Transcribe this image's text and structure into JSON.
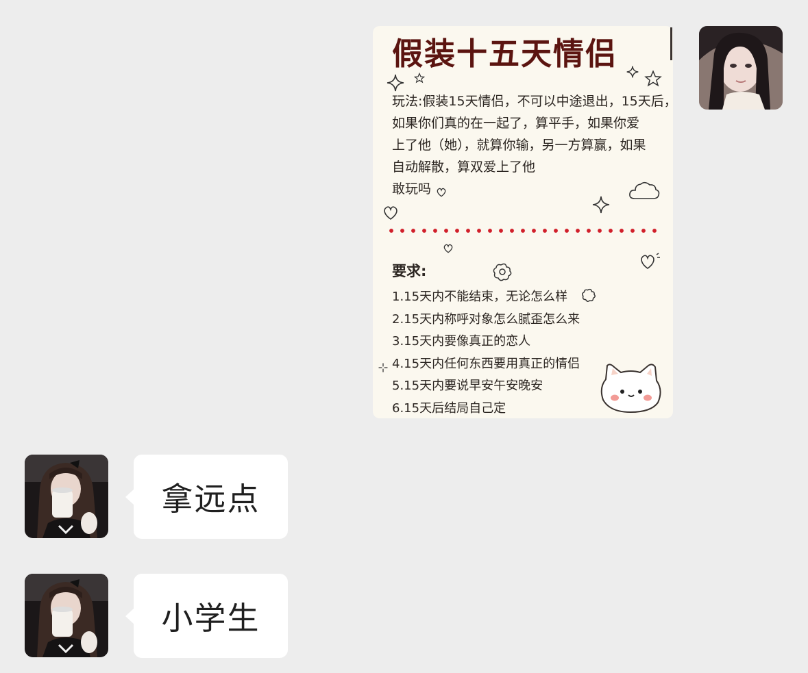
{
  "messages": {
    "image_post": {
      "sender": "me",
      "title": "假装十五天情侣",
      "rules_lines": [
        "玩法:假装15天情侣，不可以中途退出，15天后，",
        "如果你们真的在一起了，算平手，如果你爱",
        "上了他（她），就算你输，另一方算赢，如果",
        "自动解散，算双爱上了他",
        "敢玩吗"
      ],
      "requirements_title": "要求:",
      "requirements": [
        "1.15天内不能结束，无论怎么样",
        "2.15天内称呼对象怎么腻歪怎么来",
        "3.15天内要像真正的恋人",
        "4.15天内任何东西要用真正的情侣",
        "5.15天内要说早安午安晚安",
        "6.15天后结局自己定"
      ],
      "accent_colors": {
        "title": "#5b1410",
        "divider_dots": "#d11f2a",
        "card_background": "#fbf8ef"
      }
    },
    "reply_1": {
      "sender": "other",
      "text": "拿远点"
    },
    "reply_2": {
      "sender": "other",
      "text": "小学生"
    }
  },
  "colors": {
    "chat_background": "#ededed",
    "bubble_background": "#ffffff"
  },
  "icons": [
    "sparkle-icon",
    "star-icon",
    "heart-icon",
    "cloud-icon",
    "flower-icon",
    "cat-sticker-icon"
  ]
}
